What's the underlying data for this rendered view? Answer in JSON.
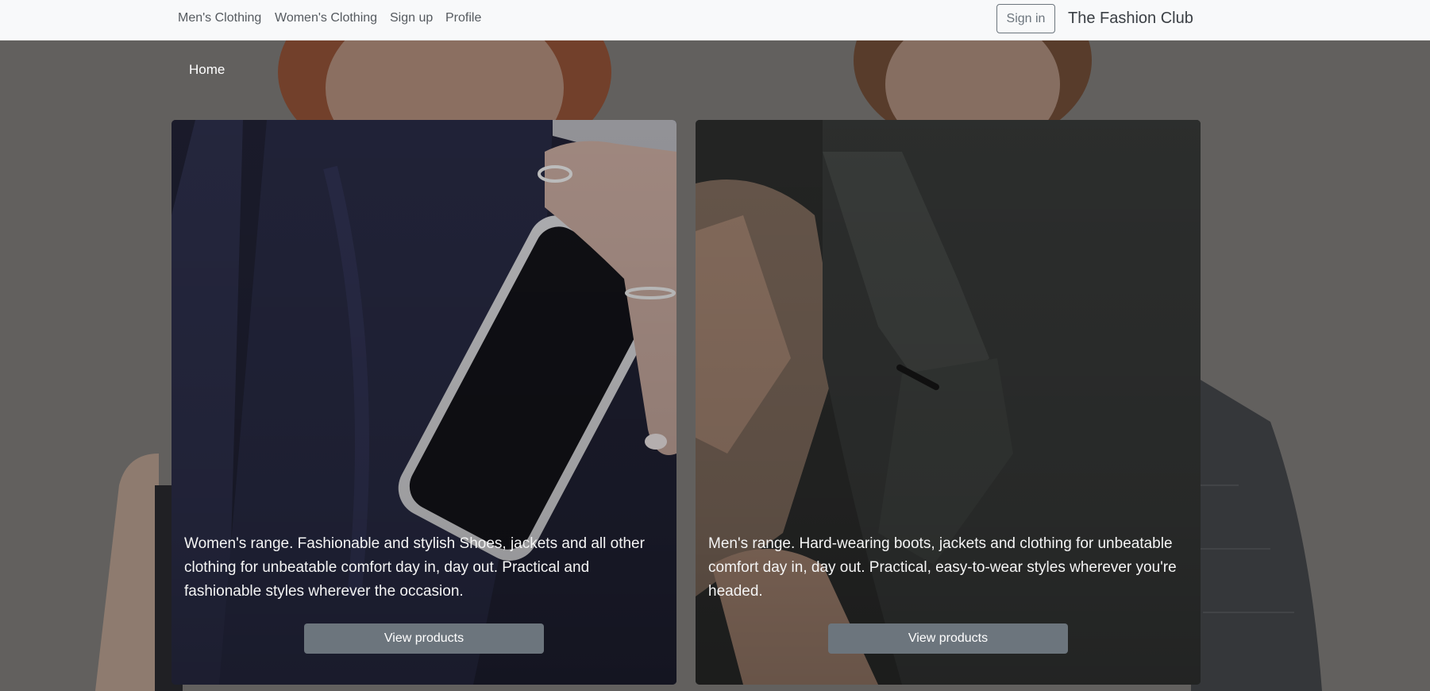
{
  "nav": {
    "links": [
      {
        "label": "Men's Clothing"
      },
      {
        "label": "Women's Clothing"
      },
      {
        "label": "Sign up"
      },
      {
        "label": "Profile"
      }
    ],
    "signin_label": "Sign in",
    "brand": "The Fashion Club"
  },
  "hero": {
    "home_label": "Home"
  },
  "cards": [
    {
      "text": "Women's range. Fashionable and stylish Shoes, jackets and all other clothing for unbeatable comfort day in, day out. Practical and fashionable styles wherever the occasion.",
      "button_label": "View products"
    },
    {
      "text": "Men's range. Hard-wearing boots, jackets and clothing for unbeatable comfort day in, day out. Practical, easy-to-wear styles wherever you're headed.",
      "button_label": "View products"
    }
  ],
  "colors": {
    "navbar_bg": "#f8f9fa",
    "secondary": "#6c757d",
    "hero_overlay": "rgba(40,40,40,0.42)"
  }
}
